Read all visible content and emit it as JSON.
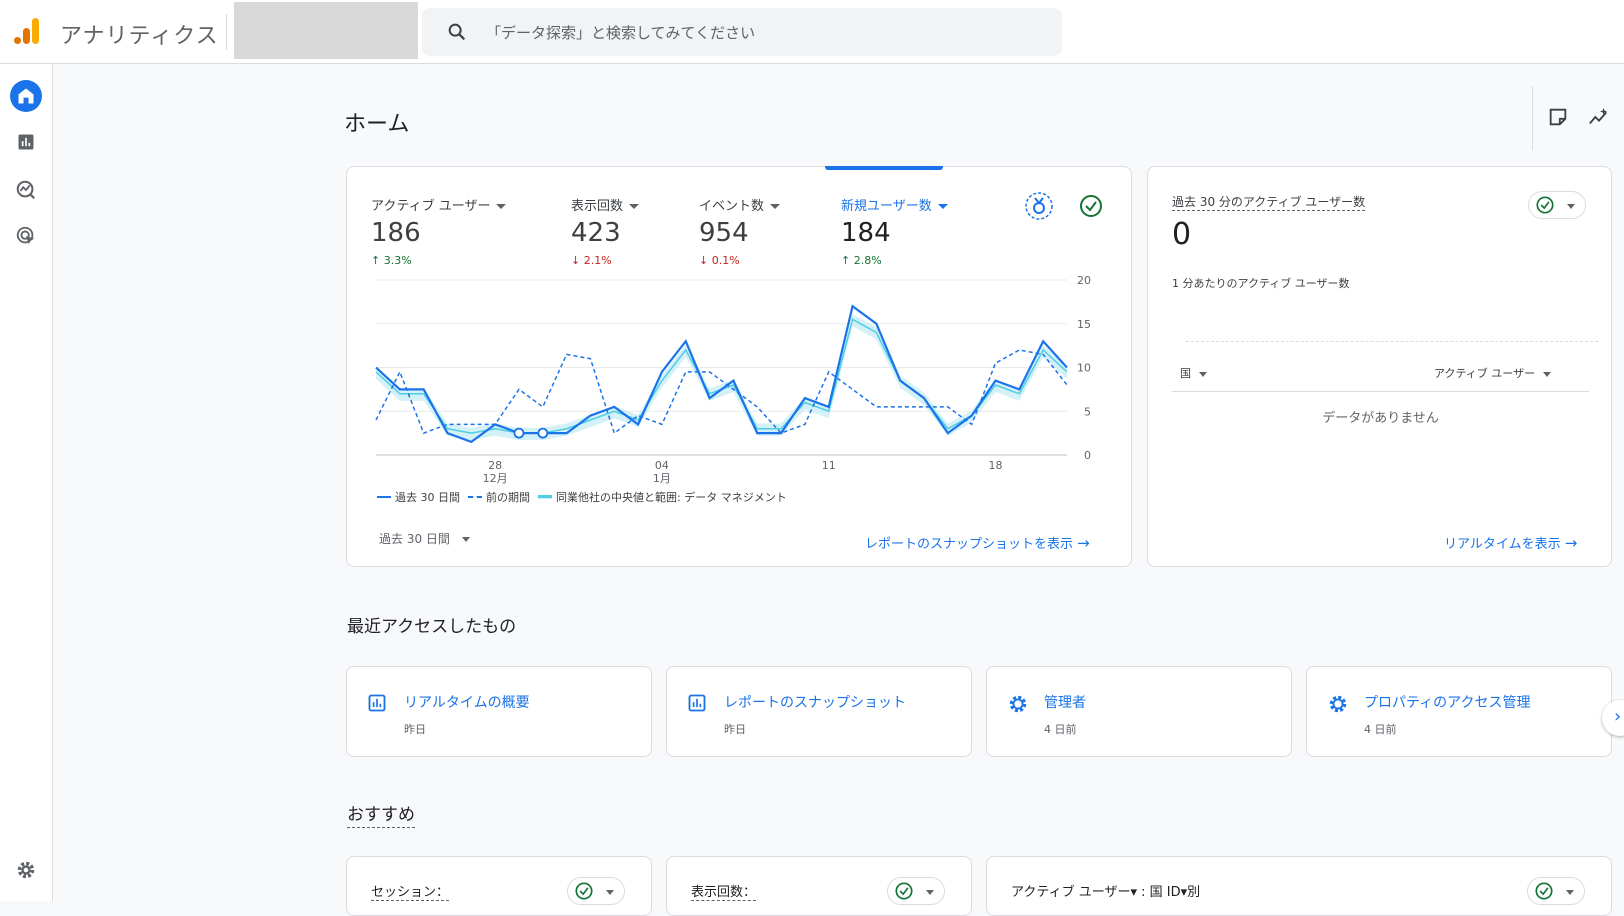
{
  "app": {
    "name": "アナリティクス"
  },
  "search": {
    "placeholder": "「データ探索」と検索してみてください"
  },
  "page": {
    "title": "ホーム"
  },
  "colors": {
    "accent": "#1a73e8",
    "up": "#137333",
    "down": "#c5221f",
    "benchmark": "#4ecde6"
  },
  "metrics": [
    {
      "label": "アクティブ ユーザー",
      "value": "186",
      "change": "3.3%",
      "direction": "up"
    },
    {
      "label": "表示回数",
      "value": "423",
      "change": "2.1%",
      "direction": "down"
    },
    {
      "label": "イベント数",
      "value": "954",
      "change": "0.1%",
      "direction": "down"
    },
    {
      "label": "新規ユーザー数",
      "value": "184",
      "change": "2.8%",
      "direction": "up",
      "selected": true
    }
  ],
  "chart_data": {
    "type": "line",
    "title": "",
    "ylim": [
      0,
      20
    ],
    "y_ticks": [
      "20",
      "15",
      "10",
      "5",
      "0"
    ],
    "x_ticks": [
      {
        "day": "28",
        "month": "12月"
      },
      {
        "day": "04",
        "month": "1月"
      },
      {
        "day": "11",
        "month": ""
      },
      {
        "day": "18",
        "month": ""
      }
    ],
    "x": [
      1,
      2,
      3,
      4,
      5,
      6,
      7,
      8,
      9,
      10,
      11,
      12,
      13,
      14,
      15,
      16,
      17,
      18,
      19,
      20,
      21,
      22,
      23,
      24,
      25,
      26,
      27,
      28,
      29,
      30
    ],
    "series": [
      {
        "name": "過去 30 日間",
        "style": "solid",
        "values": [
          10,
          7.5,
          7.5,
          2.5,
          1.5,
          3.5,
          2.5,
          2.5,
          2.5,
          4.5,
          5.5,
          3.5,
          9.5,
          13,
          6.5,
          8.5,
          2.5,
          2.5,
          6.5,
          5.5,
          17,
          15,
          8.5,
          6.5,
          2.5,
          4.5,
          8.5,
          7.5,
          13,
          10
        ]
      },
      {
        "name": "前の期間",
        "style": "dashed",
        "values": [
          4,
          9.5,
          2.5,
          3.5,
          3.5,
          3.5,
          7.5,
          5.5,
          11.5,
          11,
          2.5,
          4.5,
          3.5,
          9.5,
          9.5,
          7.5,
          5.5,
          2.5,
          3.5,
          9.5,
          7.5,
          5.5,
          5.5,
          5.5,
          5.5,
          3.5,
          10.5,
          12,
          11.5,
          8
        ]
      },
      {
        "name": "同業他社の中央値と範囲: データ マネジメント",
        "style": "band",
        "values": [
          9.5,
          7,
          7,
          3,
          2.5,
          3,
          2.5,
          2.5,
          3,
          4,
          5,
          4,
          8.5,
          12,
          7,
          8,
          3,
          3,
          6,
          5,
          15.5,
          14,
          8.5,
          6.5,
          3,
          4.5,
          8,
          7,
          12,
          9.5
        ]
      }
    ],
    "legend": [
      "過去 30 日間",
      "前の期間",
      "同業他社の中央値と範囲: データ マネジメント"
    ],
    "legend_position": "bottom-left",
    "grid": true
  },
  "overview": {
    "range_label": "過去 30 日間",
    "snapshot_link": "レポートのスナップショットを表示"
  },
  "realtime": {
    "title": "過去 30 分のアクティブ ユーザー数",
    "value": "0",
    "per_minute_label": "1 分あたりのアクティブ ユーザー数",
    "col_country": "国",
    "col_users": "アクティブ ユーザー",
    "empty": "データがありません",
    "link": "リアルタイムを表示"
  },
  "recent": {
    "title": "最近アクセスしたもの",
    "items": [
      {
        "title": "リアルタイムの概要",
        "sub": "昨日",
        "icon": "report-icon"
      },
      {
        "title": "レポートのスナップショット",
        "sub": "昨日",
        "icon": "report-icon"
      },
      {
        "title": "管理者",
        "sub": "4 日前",
        "icon": "gear-icon"
      },
      {
        "title": "プロパティのアクセス管理",
        "sub": "4 日前",
        "icon": "gear-icon"
      }
    ]
  },
  "recommended": {
    "title": "おすすめ",
    "cards": [
      {
        "title": "セッション："
      },
      {
        "title": "表示回数："
      },
      {
        "title": "アクティブ ユーザー▾ : 国 ID▾別"
      }
    ]
  }
}
